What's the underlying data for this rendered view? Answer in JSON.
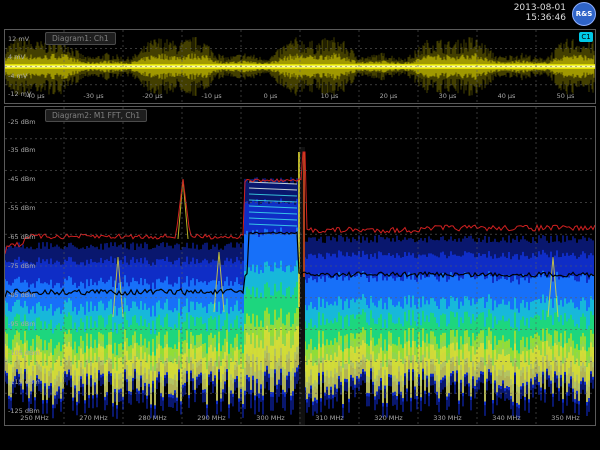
{
  "header": {
    "date": "2013-08-01",
    "time": "15:36:46",
    "logo_text": "R&S"
  },
  "waveform": {
    "title": "Diagram1: Ch1",
    "channel_badge": "C1",
    "y_ticks": [
      "12 mV",
      "4 mV",
      "-4 mV",
      "-12 mV"
    ],
    "x_ticks": [
      "-40 µs",
      "-30 µs",
      "-20 µs",
      "-10 µs",
      "0 µs",
      "10 µs",
      "20 µs",
      "30 µs",
      "40 µs",
      "50 µs"
    ],
    "trace_color": "#e6e600"
  },
  "spectrum": {
    "title": "Diagram2: M1 FFT, Ch1",
    "y_ticks": [
      "-25 dBm",
      "-35 dBm",
      "-45 dBm",
      "-55 dBm",
      "-65 dBm",
      "-75 dBm",
      "-85 dBm",
      "-95 dBm",
      "-105 dBm",
      "-115 dBm",
      "-125 dBm"
    ],
    "x_ticks": [
      "250 MHz",
      "270 MHz",
      "280 MHz",
      "290 MHz",
      "300 MHz",
      "310 MHz",
      "320 MHz",
      "330 MHz",
      "340 MHz",
      "350 MHz"
    ],
    "maxhold_color": "#d02020",
    "average_color": "#000000"
  }
}
